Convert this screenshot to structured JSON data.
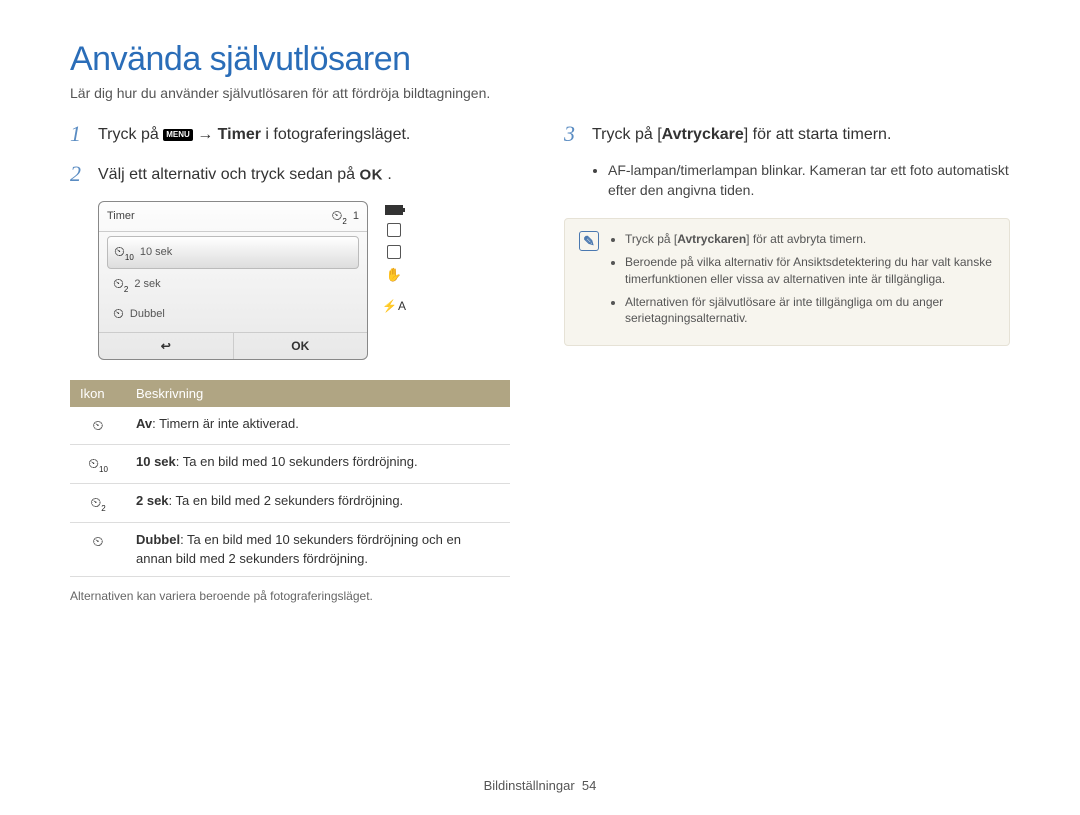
{
  "heading": "Använda självutlösaren",
  "subheading": "Lär dig hur du använder självutlösaren för att fördröja bildtagningen.",
  "steps": {
    "s1": {
      "num": "1",
      "pre": "Tryck på ",
      "mid": " → ",
      "bold": "Timer",
      "post": " i fotograferingsläget."
    },
    "s2": {
      "num": "2",
      "text": "Välj ett alternativ och tryck sedan på "
    },
    "s3": {
      "num": "3",
      "pre": "Tryck på [",
      "bold": "Avtryckare",
      "post": "] för att starta timern."
    }
  },
  "screen": {
    "title": "Timer",
    "header_icon_sub": "2",
    "counter": "1",
    "items": [
      {
        "sub": "10",
        "label": "10 sek"
      },
      {
        "sub": "2",
        "label": "2 sek"
      },
      {
        "sub": "",
        "label": "Dubbel"
      }
    ],
    "back": "↩",
    "ok": "OK"
  },
  "bottom_right_label": "A",
  "table": {
    "h1": "Ikon",
    "h2": "Beskrivning",
    "rows": [
      {
        "sub": "",
        "bold": "Av",
        "desc": ": Timern är inte aktiverad."
      },
      {
        "sub": "10",
        "bold": "10 sek",
        "desc": ": Ta en bild med 10 sekunders fördröjning."
      },
      {
        "sub": "2",
        "bold": "2 sek",
        "desc": ": Ta en bild med 2 sekunders fördröjning."
      },
      {
        "sub": "",
        "bold": "Dubbel",
        "desc": ": Ta en bild med 10 sekunders fördröjning och en annan bild med 2 sekunders fördröjning."
      }
    ]
  },
  "footnote": "Alternativen kan variera beroende på fotograferingsläget.",
  "right_bullets": [
    "AF-lampan/timerlampan blinkar. Kameran tar ett foto automatiskt efter den angivna tiden."
  ],
  "note": {
    "b1_pre": "Tryck på [",
    "b1_bold": "Avtryckaren",
    "b1_post": "] för att avbryta timern.",
    "b2": "Beroende på vilka alternativ för Ansiktsdetektering du har valt kanske timerfunktionen eller vissa av alternativen inte är tillgängliga.",
    "b3": "Alternativen för självutlösare är inte tillgängliga om du anger serietagningsalternativ."
  },
  "page_footer": {
    "section": "Bildinställningar",
    "page": "54"
  },
  "menu_label": "MENU",
  "ok_label": "OK"
}
